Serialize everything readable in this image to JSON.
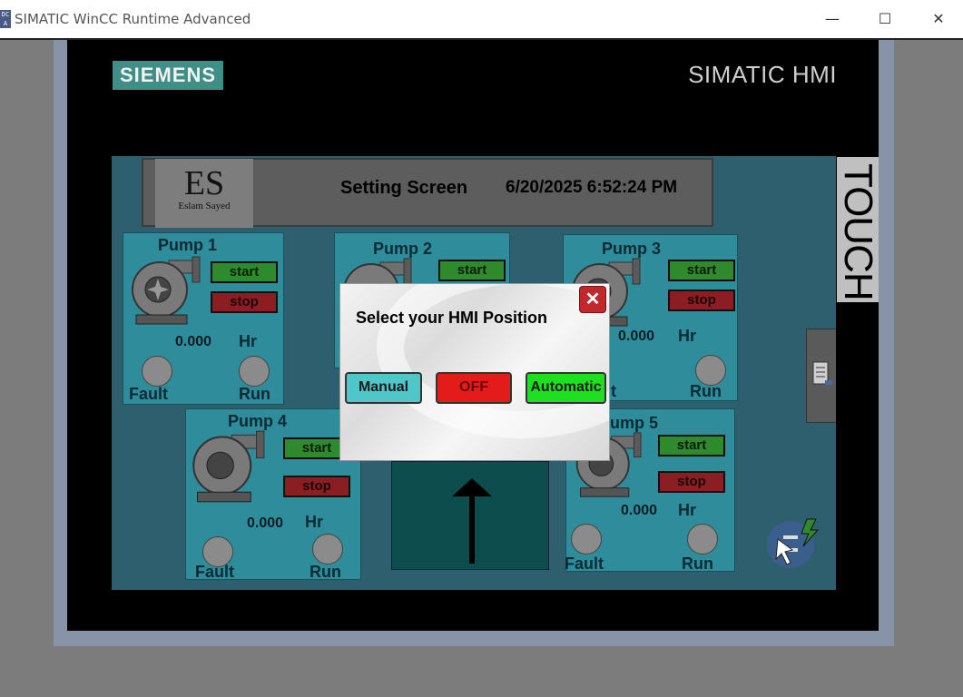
{
  "window": {
    "title": "SIMATIC WinCC Runtime Advanced",
    "icon_text": "DC\nA",
    "controls": {
      "minimize": "—",
      "maximize": "☐",
      "close": "✕"
    }
  },
  "bezel": {
    "brand": "SIEMENS",
    "product": "SIMATIC HMI",
    "touch_label": "TOUCH"
  },
  "header": {
    "logo_initials": "ES",
    "logo_name": "Eslam Sayed",
    "title": "Setting Screen",
    "datetime": "6/20/2025 6:52:24 PM"
  },
  "pumps": [
    {
      "title": "Pump 1",
      "start": "start",
      "stop": "stop",
      "value": "0.000",
      "unit": "Hr",
      "fault": "Fault",
      "run": "Run"
    },
    {
      "title": "Pump 2",
      "start": "start"
    },
    {
      "title": "Pump 3",
      "start": "start",
      "stop": "stop",
      "value": "0.000",
      "unit": "Hr",
      "run": "Run",
      "fault_partial": "t"
    },
    {
      "title": "Pump 4",
      "start": "start",
      "stop": "stop",
      "value": "0.000",
      "unit": "Hr",
      "fault": "Fault",
      "run": "Run"
    },
    {
      "title": "ump 5",
      "start": "start",
      "stop": "stop",
      "value": "0.000",
      "unit": "Hr",
      "fault": "Fault",
      "run": "Run"
    }
  ],
  "dialog": {
    "title": "Select your  HMI Position",
    "close": "✕",
    "buttons": {
      "manual": "Manual",
      "off": "OFF",
      "automatic": "Automatic"
    }
  },
  "colors": {
    "start_green": "#2f8a2e",
    "stop_red": "#8a1e22",
    "panel_blue": "#2f8d9b",
    "dialog_manual": "#4fc6c8",
    "dialog_off": "#e31b1b",
    "dialog_auto": "#1fe01f"
  }
}
